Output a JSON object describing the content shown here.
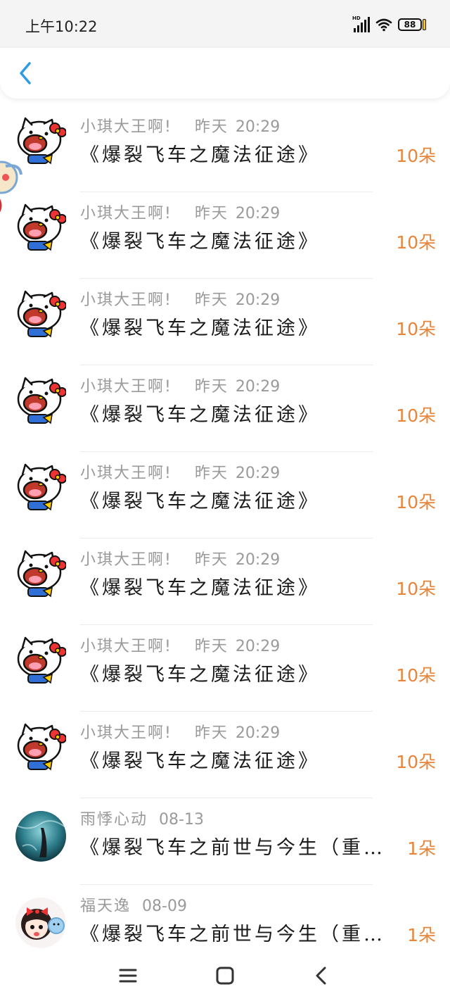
{
  "status_bar": {
    "time": "上午10:22",
    "signal_tag": "HD",
    "battery": "88",
    "icons": [
      "signal-icon",
      "wifi-icon",
      "battery-icon"
    ]
  },
  "header": {
    "back_icon": "chevron-left-icon"
  },
  "gifts": [
    {
      "name": "小琪大王啊!",
      "date": "昨天",
      "time": "20:29",
      "title": "《爆裂飞车之魔法征途》",
      "amount": "10朵",
      "avatar": "hello-kitty"
    },
    {
      "name": "小琪大王啊!",
      "date": "昨天",
      "time": "20:29",
      "title": "《爆裂飞车之魔法征途》",
      "amount": "10朵",
      "avatar": "hello-kitty"
    },
    {
      "name": "小琪大王啊!",
      "date": "昨天",
      "time": "20:29",
      "title": "《爆裂飞车之魔法征途》",
      "amount": "10朵",
      "avatar": "hello-kitty"
    },
    {
      "name": "小琪大王啊!",
      "date": "昨天",
      "time": "20:29",
      "title": "《爆裂飞车之魔法征途》",
      "amount": "10朵",
      "avatar": "hello-kitty"
    },
    {
      "name": "小琪大王啊!",
      "date": "昨天",
      "time": "20:29",
      "title": "《爆裂飞车之魔法征途》",
      "amount": "10朵",
      "avatar": "hello-kitty"
    },
    {
      "name": "小琪大王啊!",
      "date": "昨天",
      "time": "20:29",
      "title": "《爆裂飞车之魔法征途》",
      "amount": "10朵",
      "avatar": "hello-kitty"
    },
    {
      "name": "小琪大王啊!",
      "date": "昨天",
      "time": "20:29",
      "title": "《爆裂飞车之魔法征途》",
      "amount": "10朵",
      "avatar": "hello-kitty"
    },
    {
      "name": "小琪大王啊!",
      "date": "昨天",
      "time": "20:29",
      "title": "《爆裂飞车之魔法征途》",
      "amount": "10朵",
      "avatar": "hello-kitty"
    },
    {
      "name": "雨悸心动",
      "date": "08-13",
      "time": "",
      "title": "《爆裂飞车之前世与今生（重…",
      "amount": "1朵",
      "avatar": "photo-teal"
    },
    {
      "name": "福天逸",
      "date": "08-09",
      "time": "",
      "title": "《爆裂飞车之前世与今生（重…",
      "amount": "1朵",
      "avatar": "cartoon-girl"
    }
  ],
  "colors": {
    "accent": "#2f9be6",
    "amount": "#e8853a",
    "meta": "#9a9a9a",
    "title": "#1a1a1a"
  },
  "nav_bar": {
    "icons": [
      "menu-icon",
      "home-square-icon",
      "back-triangle-icon"
    ]
  }
}
